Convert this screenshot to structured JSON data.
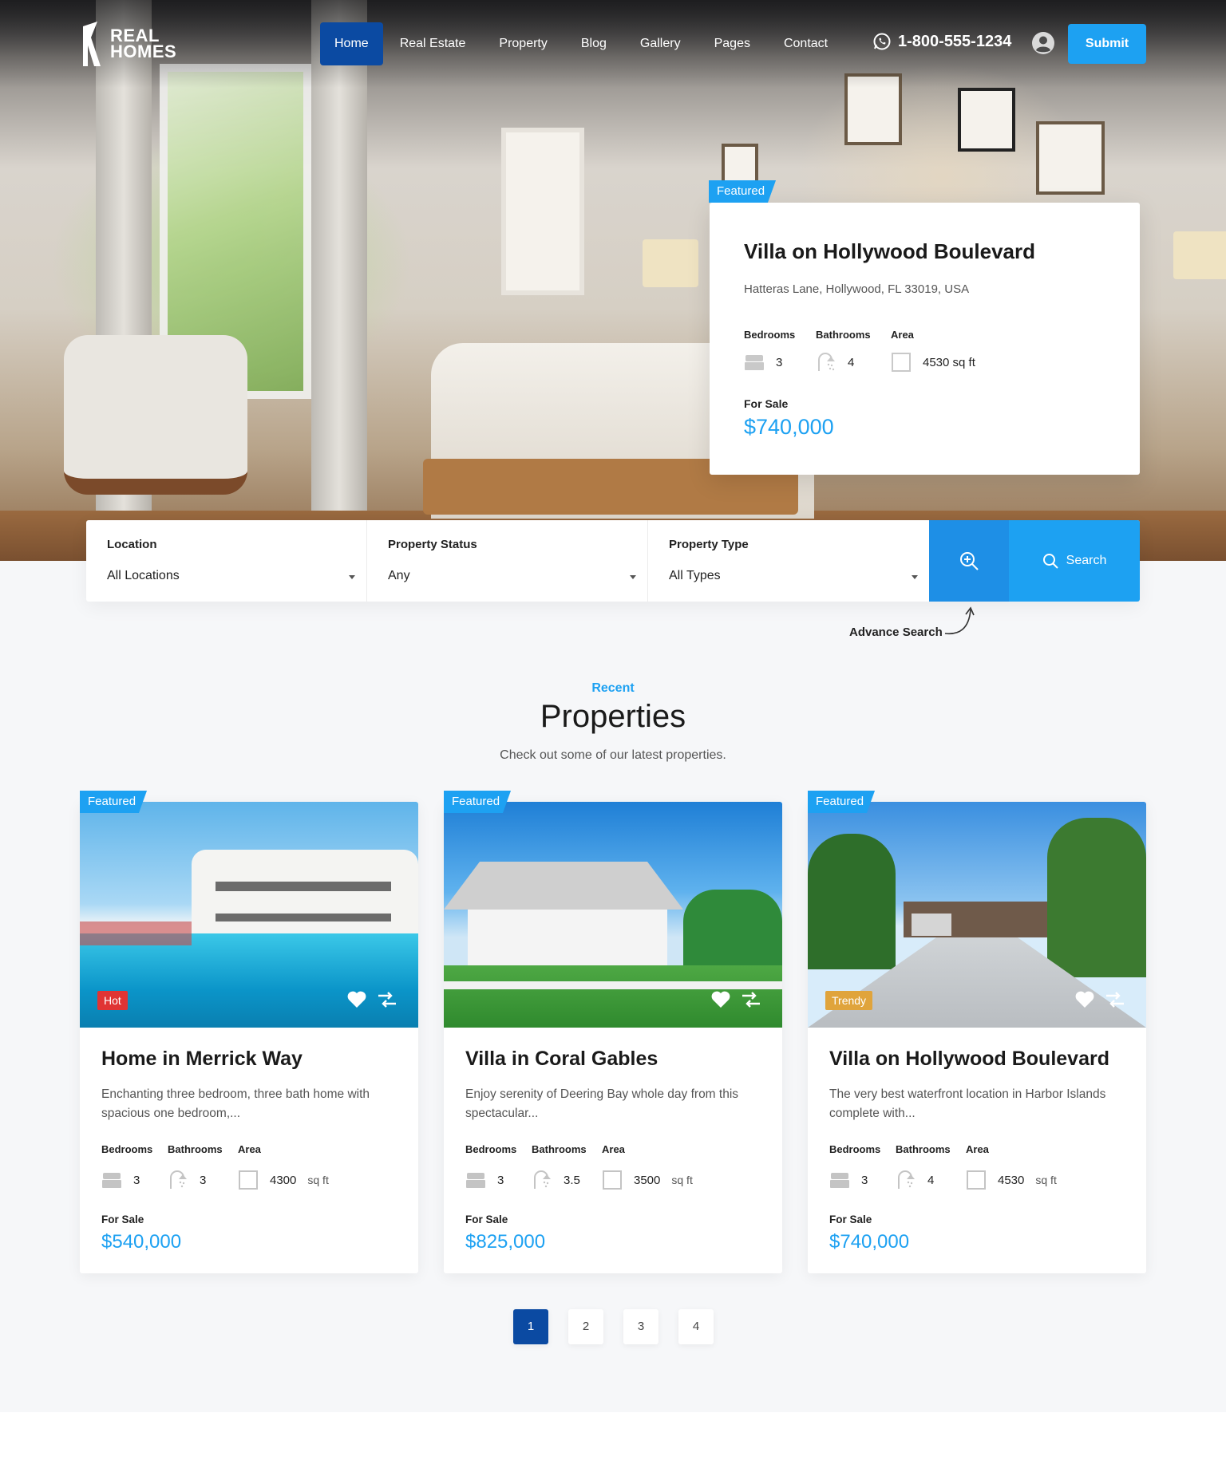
{
  "brand": {
    "line1": "REAL",
    "line2": "HOMES"
  },
  "nav": {
    "items": [
      {
        "label": "Home",
        "active": true
      },
      {
        "label": "Real Estate"
      },
      {
        "label": "Property"
      },
      {
        "label": "Blog"
      },
      {
        "label": "Gallery"
      },
      {
        "label": "Pages"
      },
      {
        "label": "Contact"
      }
    ],
    "phone": "1-800-555-1234",
    "submit_label": "Submit"
  },
  "hero_card": {
    "tag": "Featured",
    "title": "Villa on Hollywood Boulevard",
    "address": "Hatteras Lane, Hollywood, FL 33019, USA",
    "bedrooms_label": "Bedrooms",
    "bedrooms": "3",
    "bathrooms_label": "Bathrooms",
    "bathrooms": "4",
    "area_label": "Area",
    "area": "4530 sq ft",
    "status": "For Sale",
    "price": "$740,000"
  },
  "search": {
    "location_label": "Location",
    "location_value": "All Locations",
    "status_label": "Property Status",
    "status_value": "Any",
    "type_label": "Property Type",
    "type_value": "All Types",
    "search_label": "Search",
    "advance_label": "Advance Search"
  },
  "section": {
    "tag": "Recent",
    "title": "Properties",
    "subtitle": "Check out some of our latest properties."
  },
  "properties": [
    {
      "tag": "Featured",
      "badge": "Hot",
      "badge_color": "#e03434",
      "title": "Home in Merrick Way",
      "desc": "Enchanting three bedroom, three bath home with spacious one bedroom,...",
      "bedrooms_label": "Bedrooms",
      "bedrooms": "3",
      "bathrooms_label": "Bathrooms",
      "bathrooms": "3",
      "area_label": "Area",
      "area": "4300",
      "area_unit": "sq ft",
      "status": "For Sale",
      "price": "$540,000"
    },
    {
      "tag": "Featured",
      "badge": "",
      "title": "Villa in Coral Gables",
      "desc": "Enjoy serenity of Deering Bay whole day from this spectacular...",
      "bedrooms_label": "Bedrooms",
      "bedrooms": "3",
      "bathrooms_label": "Bathrooms",
      "bathrooms": "3.5",
      "area_label": "Area",
      "area": "3500",
      "area_unit": "sq ft",
      "status": "For Sale",
      "price": "$825,000"
    },
    {
      "tag": "Featured",
      "badge": "Trendy",
      "badge_color": "#e0a43c",
      "title": "Villa on Hollywood Boulevard",
      "desc": "The very best waterfront location in Harbor Islands complete with...",
      "bedrooms_label": "Bedrooms",
      "bedrooms": "3",
      "bathrooms_label": "Bathrooms",
      "bathrooms": "4",
      "area_label": "Area",
      "area": "4530",
      "area_unit": "sq ft",
      "status": "For Sale",
      "price": "$740,000"
    }
  ],
  "pagination": {
    "pages": [
      "1",
      "2",
      "3",
      "4"
    ],
    "current": "1"
  },
  "colors": {
    "accent": "#1da1f2",
    "nav_active": "#0b4aa2",
    "hot": "#e03434",
    "trendy": "#e0a43c"
  },
  "icons": [
    "whatsapp-icon",
    "user-icon",
    "bed-icon",
    "shower-icon",
    "area-icon",
    "zoom-plus-icon",
    "search-icon",
    "heart-icon",
    "compare-icon"
  ]
}
